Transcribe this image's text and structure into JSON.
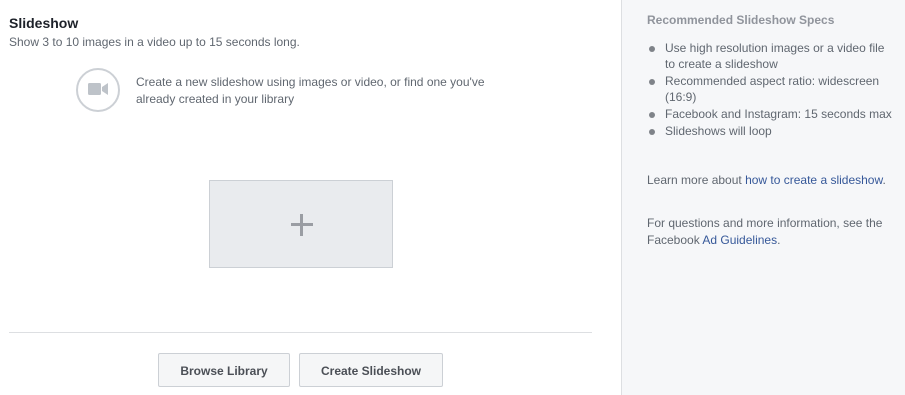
{
  "main": {
    "title": "Slideshow",
    "subtitle": "Show 3 to 10 images in a video up to 15 seconds long.",
    "hint": "Create a new slideshow using images or video, or find one you've already created in your library",
    "dropzone_icon": "plus-icon",
    "video_icon": "video-camera-icon"
  },
  "buttons": {
    "browse_label": "Browse Library",
    "create_label": "Create Slideshow"
  },
  "specs": {
    "title": "Recommended Slideshow Specs",
    "items": [
      "Use high resolution images or a video file to create a slideshow",
      "Recommended aspect ratio: widescreen (16:9)",
      "Facebook and Instagram: 15 seconds max",
      "Slideshows will loop"
    ],
    "learn_prefix": "Learn more about ",
    "learn_link": "how to create a slideshow",
    "learn_suffix": ".",
    "questions_prefix": "For questions and more information, see the Facebook ",
    "questions_link": "Ad Guidelines",
    "questions_suffix": "."
  },
  "colors": {
    "link": "#365899",
    "panel_bg": "#f6f7f9",
    "dropzone_bg": "#e9ebee"
  }
}
